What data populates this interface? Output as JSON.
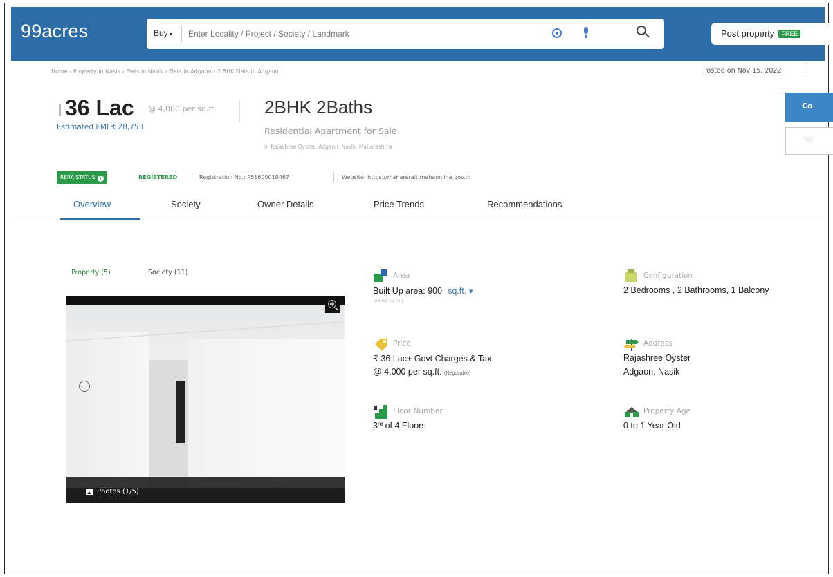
{
  "header": {
    "logo": "99acres",
    "search": {
      "buy_label": "Buy",
      "caret": "▾",
      "placeholder": "Enter Locality / Project / Society / Landmark"
    },
    "post_property": {
      "label": "Post property",
      "badge": "FREE"
    }
  },
  "breadcrumb": "Home › Property in Nasik › Flats in Nasik › Flats in Adgaon › 2 BHK Flats in Adgaon",
  "posted_on": "Posted on Nov 15, 2022",
  "listing": {
    "price": "36 Lac",
    "price_per_sqft": "@ 4,000 per sq.ft.",
    "emi": "Estimated EMI ₹ 28,753",
    "title": "2BHK 2Baths",
    "subtitle": "Residential Apartment for Sale",
    "location": "in Rajashree Oyster, Adgaon, Nasik, Maharashtra",
    "contact_label": "Co",
    "phone_label": "☏"
  },
  "rera": {
    "status_label": "RERA STATUS",
    "info_glyph": "i",
    "registered": "REGISTERED",
    "registration_no": "Registration No.: P51600010467",
    "website": "Website: https://maharerait.mahaonline.gov.in"
  },
  "tabs": [
    {
      "label": "Overview",
      "active": true
    },
    {
      "label": "Society",
      "active": false
    },
    {
      "label": "Owner Details",
      "active": false
    },
    {
      "label": "Price Trends",
      "active": false
    },
    {
      "label": "Recommendations",
      "active": false
    }
  ],
  "media_tabs": [
    {
      "label": "Property (5)",
      "active": true
    },
    {
      "label": "Society (11)",
      "active": false
    }
  ],
  "photo": {
    "count_label": "Photos (1/5)"
  },
  "details": {
    "area": {
      "label": "Area",
      "value": "Built Up area: 900",
      "unit": "sq.ft. ▾",
      "note": "(83.61 sq.m.)"
    },
    "configuration": {
      "label": "Configuration",
      "value": "2 Bedrooms , 2 Bathrooms, 1 Balcony"
    },
    "price": {
      "label": "Price",
      "value": "₹ 36 Lac+ Govt Charges & Tax",
      "value2": "@ 4,000 per sq.ft.",
      "negotiable": "(Negotiable)"
    },
    "address": {
      "label": "Address",
      "line1": "Rajashree Oyster",
      "line2": "Adgaon, Nasik"
    },
    "floor": {
      "label": "Floor Number",
      "floor": "3",
      "suffix": "rd",
      "rest": "of 4 Floors"
    },
    "age": {
      "label": "Property Age",
      "value": "0 to 1 Year Old"
    }
  },
  "colors": {
    "header_blue": "#2c6da8",
    "accent_green": "#2b9a48",
    "link_blue": "#3a7ab8"
  }
}
